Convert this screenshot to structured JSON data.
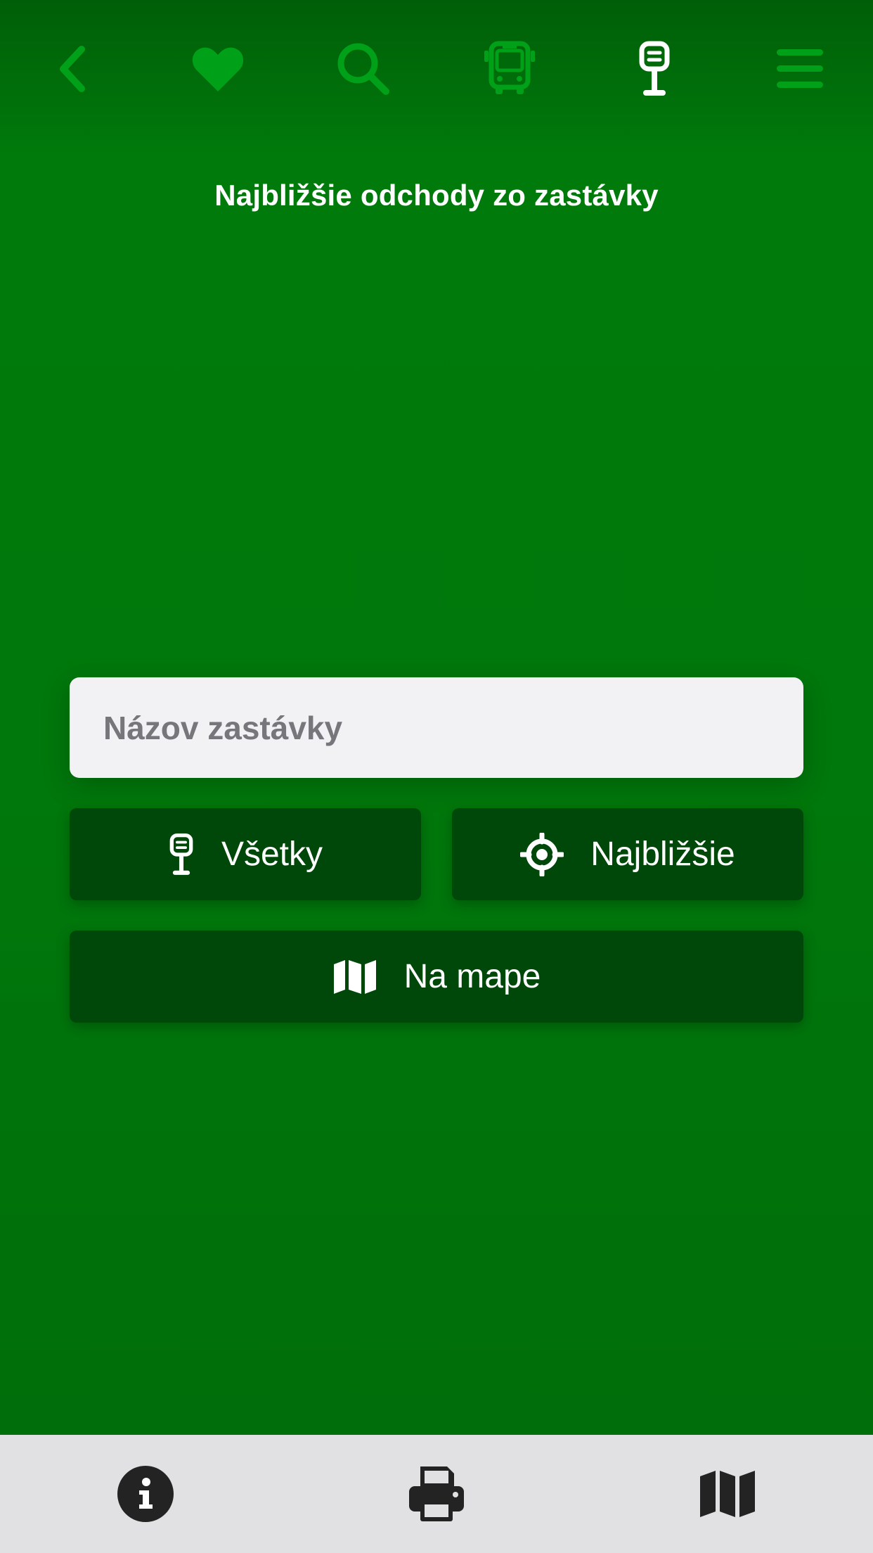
{
  "topbar": {
    "icons": [
      {
        "name": "back-icon",
        "color": "#00a018"
      },
      {
        "name": "heart-icon",
        "color": "#00a018"
      },
      {
        "name": "search-icon",
        "color": "#00a018"
      },
      {
        "name": "bus-icon",
        "color": "#00a018"
      },
      {
        "name": "bus-stop-icon",
        "color": "#ffffff",
        "active": true
      },
      {
        "name": "menu-icon",
        "color": "#00a018"
      }
    ]
  },
  "page": {
    "title": "Najbližšie odchody zo zastávky"
  },
  "search": {
    "placeholder": "Názov zastávky",
    "value": ""
  },
  "buttons": {
    "all_label": "Všetky",
    "nearest_label": "Najbližšie",
    "map_label": "Na mape"
  },
  "bottombar": {
    "icons": [
      "info-icon",
      "printer-icon",
      "map-icon"
    ]
  },
  "colors": {
    "background": "#007a0b",
    "button": "#00470a",
    "icon_inactive": "#00a018",
    "icon_active": "#ffffff",
    "bottombar": "#e1e0e2",
    "bottom_icon": "#232323"
  }
}
